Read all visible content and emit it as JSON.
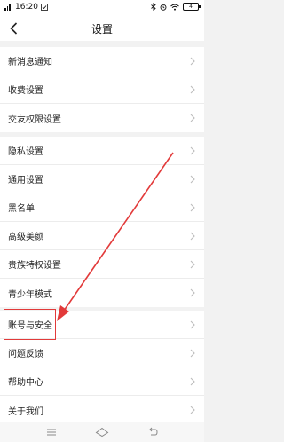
{
  "status_bar": {
    "time": "16:20",
    "battery": "4"
  },
  "header": {
    "title": "设置"
  },
  "groups": [
    {
      "items": [
        {
          "label": "新消息通知"
        },
        {
          "label": "收费设置"
        },
        {
          "label": "交友权限设置"
        }
      ]
    },
    {
      "items": [
        {
          "label": "隐私设置"
        },
        {
          "label": "通用设置"
        },
        {
          "label": "黑名单"
        },
        {
          "label": "高级美颜"
        },
        {
          "label": "贵族特权设置"
        },
        {
          "label": "青少年模式"
        }
      ]
    },
    {
      "items": [
        {
          "label": "账号与安全"
        },
        {
          "label": "问题反馈"
        },
        {
          "label": "帮助中心"
        },
        {
          "label": "关于我们"
        }
      ]
    }
  ],
  "annotation": {
    "color": "#e23a3a",
    "highlighted_item": "账号与安全"
  },
  "icons": {
    "back": "chevron-left-icon",
    "row": "chevron-right-icon",
    "home_menu": "menu-icon",
    "home": "home-icon",
    "home_back": "back-icon"
  }
}
